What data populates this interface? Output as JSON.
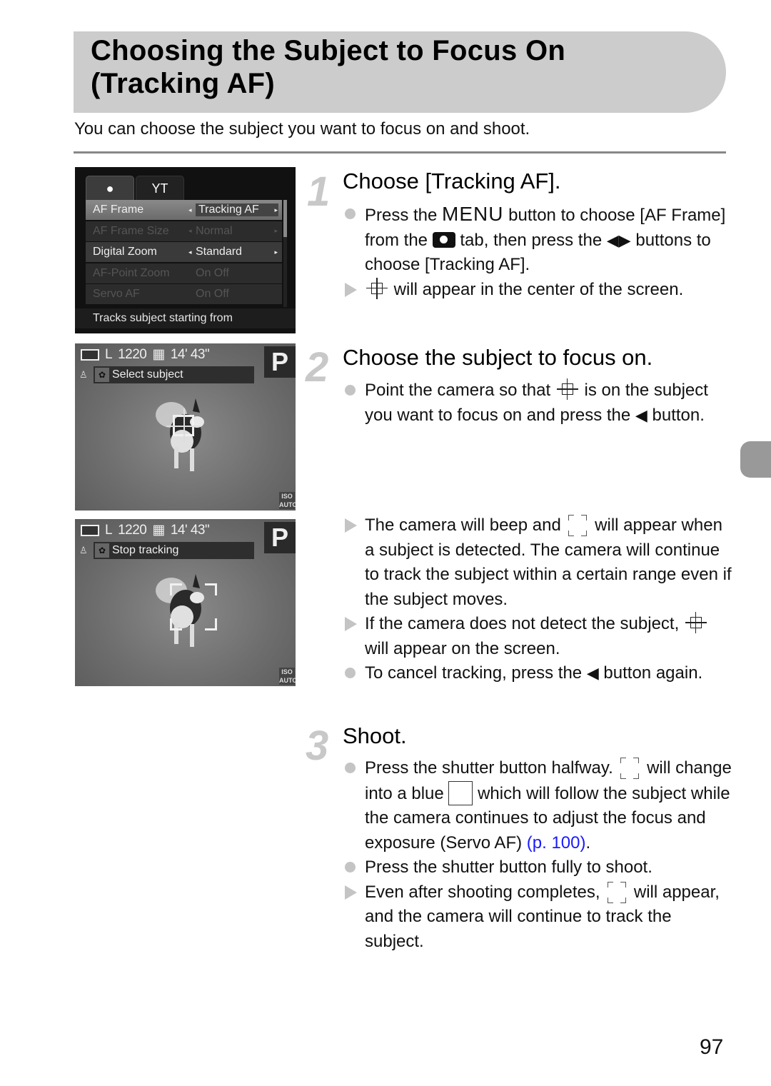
{
  "page": {
    "title_line1": "Choosing the Subject to Focus On",
    "title_line2": "(Tracking AF)",
    "intro": "You can choose the subject you want to focus on and shoot.",
    "page_number": "97"
  },
  "menu_screen": {
    "tabs": [
      {
        "icon": "camera-icon",
        "glyph": "●",
        "active": true
      },
      {
        "icon": "wrench-icon",
        "glyph": "ΥT",
        "active": false
      }
    ],
    "rows": [
      {
        "label": "AF Frame",
        "value": "Tracking AF",
        "state": "selected"
      },
      {
        "label": "AF Frame Size",
        "value": "Normal",
        "state": "disabled"
      },
      {
        "label": "Digital Zoom",
        "value": "Standard",
        "state": "enabled"
      },
      {
        "label": "AF-Point Zoom",
        "value": "On  Off",
        "state": "disabled"
      },
      {
        "label": "Servo AF",
        "value": "On  Off",
        "state": "disabled"
      }
    ],
    "help_text": "Tracks subject starting from"
  },
  "photo_screens": [
    {
      "status": {
        "size": "L",
        "shots": "1220",
        "movie_time": "14' 43\""
      },
      "mode": "P",
      "guide_text": "Select subject",
      "iso": "ISO AUTO",
      "frame": "af-crosshair-frame"
    },
    {
      "status": {
        "size": "L",
        "shots": "1220",
        "movie_time": "14' 43\""
      },
      "mode": "P",
      "guide_text": "Stop tracking",
      "iso": "ISO AUTO",
      "frame": "tracking-corner-frame"
    }
  ],
  "steps": [
    {
      "number": "1",
      "title": "Choose [Tracking AF].",
      "items": [
        {
          "type": "bullet",
          "parts": [
            "Press the ",
            "MENU",
            " button to choose [AF Frame] from the ",
            " tab, then press the ",
            " buttons to choose [Tracking AF]."
          ]
        },
        {
          "type": "result",
          "parts": [
            " will appear in the center of the screen."
          ]
        }
      ]
    },
    {
      "number": "2",
      "title": "Choose the subject to focus on.",
      "items": [
        {
          "type": "bullet",
          "parts": [
            "Point the camera so that ",
            " is on the subject you want to focus on and press the ",
            " button."
          ]
        },
        {
          "type": "result",
          "parts": [
            "The camera will beep and ",
            " will appear when a subject is detected. The camera will continue to track the subject within a certain range even if the subject moves."
          ]
        },
        {
          "type": "result",
          "parts": [
            "If the camera does not detect the subject, ",
            " will appear on the screen."
          ]
        },
        {
          "type": "bullet",
          "parts": [
            "To cancel tracking, press the ",
            " button again."
          ]
        }
      ]
    },
    {
      "number": "3",
      "title": "Shoot.",
      "items": [
        {
          "type": "bullet",
          "parts": [
            "Press the shutter button halfway. ",
            " will change into a blue ",
            " which will follow the subject while the camera continues to adjust the focus and exposure (Servo AF) ",
            "(p. 100)",
            "."
          ]
        },
        {
          "type": "bullet",
          "parts": [
            "Press the shutter button fully to shoot."
          ]
        },
        {
          "type": "result",
          "parts": [
            "Even after shooting completes, ",
            " will appear, and the camera will continue to track the subject."
          ]
        }
      ]
    }
  ],
  "glyphs": {
    "left_right": "◀▶",
    "left": "◀",
    "arrow_left_small": "◂",
    "arrow_right_small": "▸"
  }
}
